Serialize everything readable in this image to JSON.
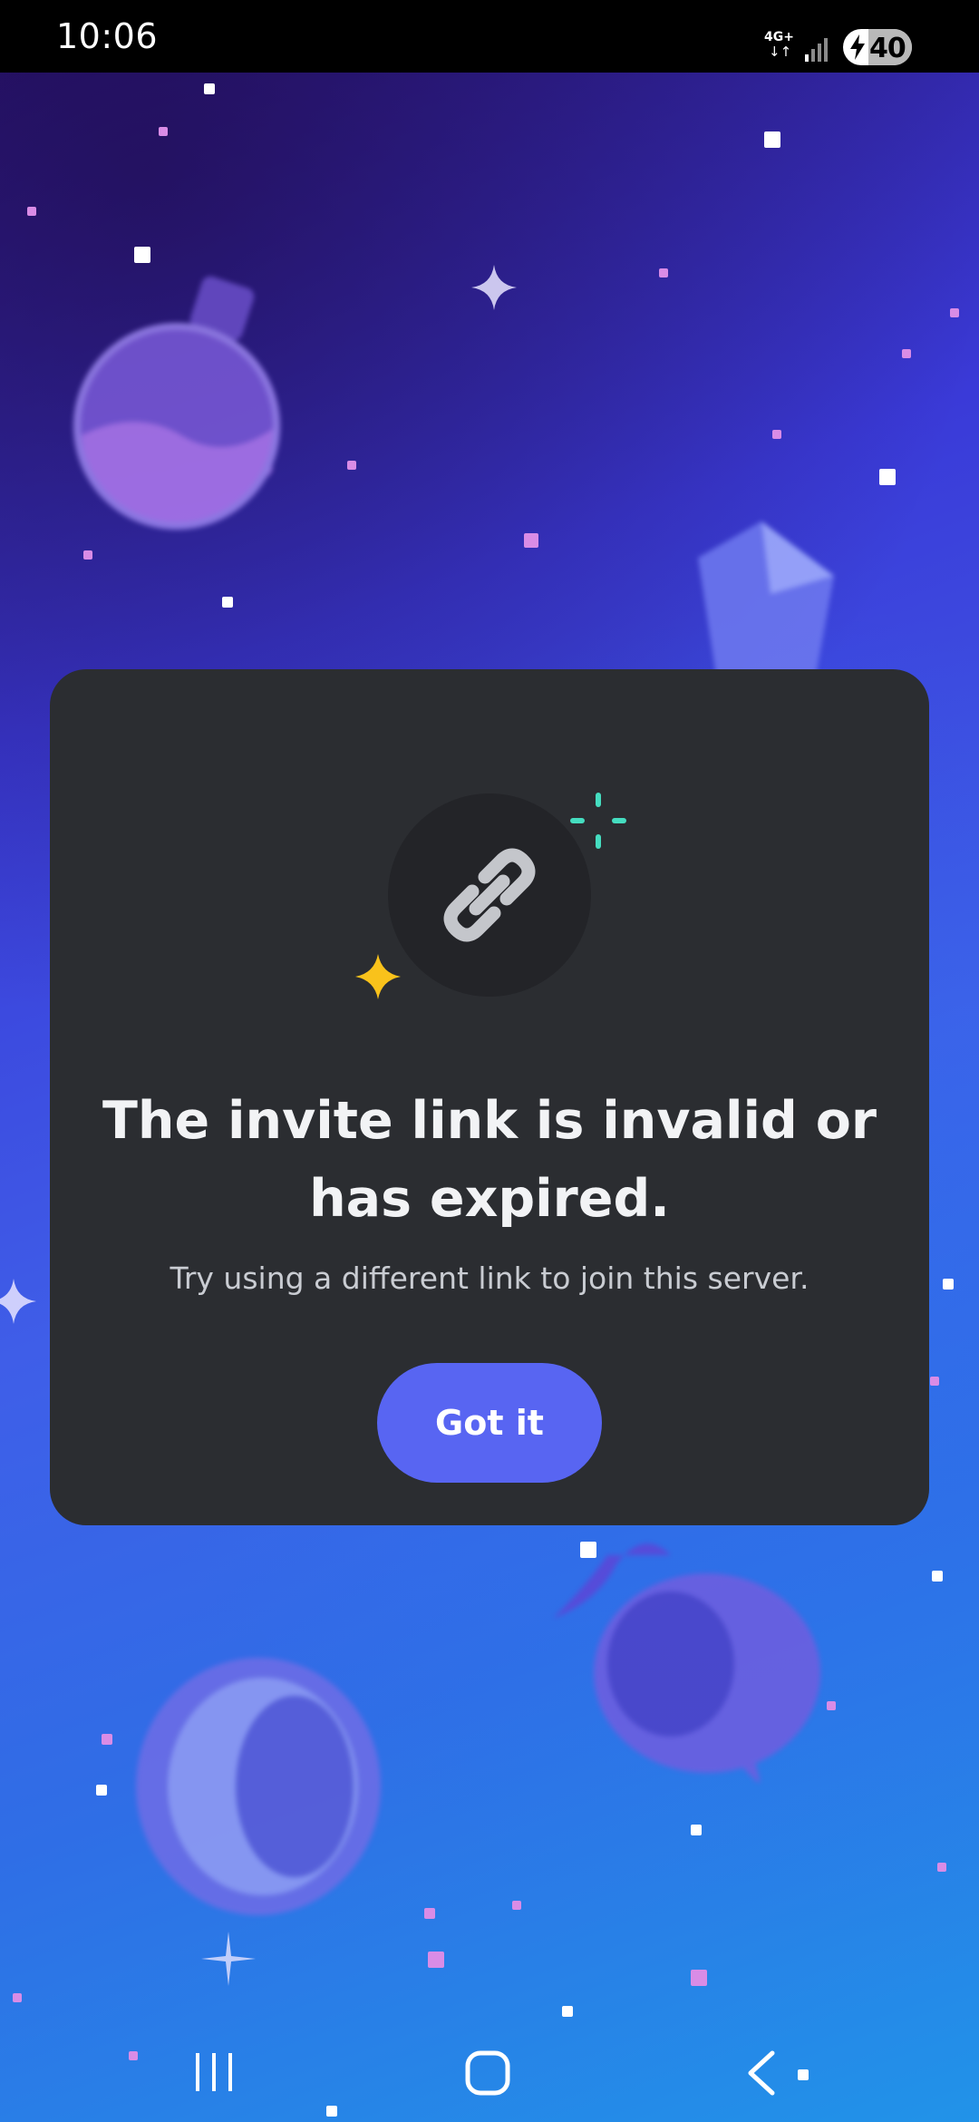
{
  "status_bar": {
    "time": "10:06",
    "network_type": "4G+",
    "data_arrows": "↓↑",
    "battery_level": "40",
    "battery_charging": true,
    "icons": [
      "signal-icon",
      "charging-bolt-icon"
    ]
  },
  "dialog": {
    "icon": "link-icon",
    "decorations": [
      "sparkle-yellow-icon",
      "sparkle-teal-icon"
    ],
    "title": "The invite link is invalid or has expired.",
    "subtitle": "Try using a different link to join this server.",
    "button_label": "Got it"
  },
  "nav_bar": {
    "icons": [
      "recent-apps-icon",
      "home-icon",
      "back-icon"
    ]
  },
  "colors": {
    "modal_background": "#2b2d31",
    "button": "#5865f2",
    "title_text": "#f2f3f5",
    "subtitle_text": "#c9ccd2",
    "sparkle_yellow": "#f9c21b",
    "sparkle_teal": "#45ddc0"
  }
}
